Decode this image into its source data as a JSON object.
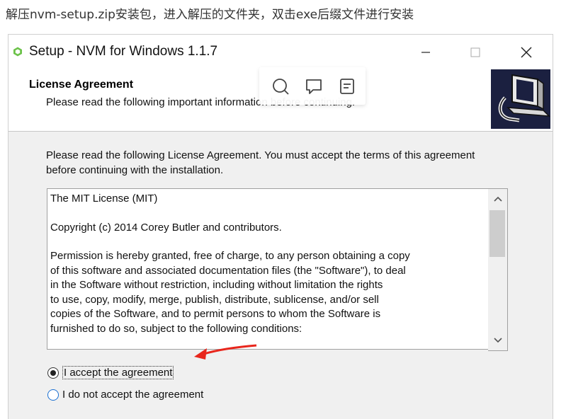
{
  "caption": "解压nvm-setup.zip安装包，进入解压的文件夹，双击exe后缀文件进行安装",
  "window": {
    "title": "Setup - NVM for Windows 1.1.7",
    "icon": "nvm-app-icon"
  },
  "header": {
    "title": "License Agreement",
    "subtitle": "Please read the following important information before continuing.",
    "logo_icon": "computer-setup-icon"
  },
  "popover": {
    "icons": [
      "search-icon",
      "comment-icon",
      "note-icon"
    ]
  },
  "intro": "Please read the following License Agreement. You must accept the terms of this agreement before continuing with the installation.",
  "license": {
    "line1": "The MIT License (MIT)",
    "line2": "Copyright (c) 2014 Corey Butler and contributors.",
    "line3": "Permission is hereby granted, free of charge, to any person obtaining a copy\nof this software and associated documentation files (the \"Software\"), to deal\nin the Software without restriction, including without limitation the rights\nto use, copy, modify, merge, publish, distribute, sublicense, and/or sell\ncopies of the Software, and to permit persons to whom the Software is\nfurnished to do so, subject to the following conditions:"
  },
  "options": {
    "accept": "I accept the agreement",
    "decline": "I do not accept the agreement",
    "selected": "accept"
  },
  "colors": {
    "logo_bg": "#1b2040",
    "arrow": "#e8261c",
    "radio_focus": "#1a6fd1"
  }
}
